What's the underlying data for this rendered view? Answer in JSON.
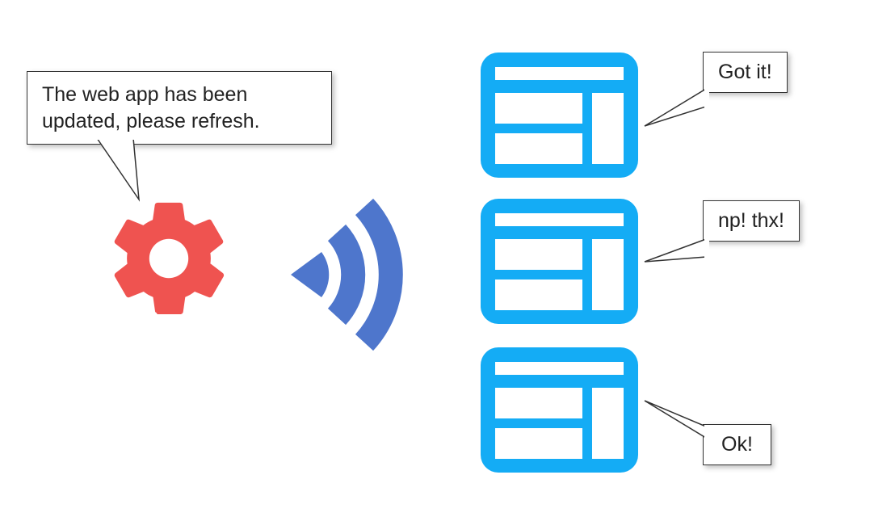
{
  "gear": {
    "message": "The web app has been updated, please refresh."
  },
  "tabs": [
    {
      "reply": "Got it!"
    },
    {
      "reply": "np! thx!"
    },
    {
      "reply": "Ok!"
    }
  ],
  "colors": {
    "gear": "#ef5350",
    "wifi": "#4e76cc",
    "tab": "#14acf5"
  }
}
